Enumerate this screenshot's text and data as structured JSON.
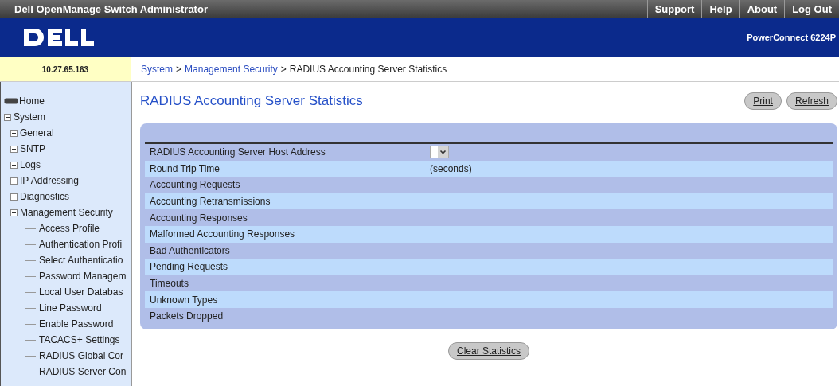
{
  "title_bar": {
    "title": "Dell OpenManage Switch Administrator",
    "links": [
      "Support",
      "Help",
      "About",
      "Log Out"
    ]
  },
  "header": {
    "product": "PowerConnect 6224P"
  },
  "ip_address": "10.27.65.163",
  "breadcrumb": [
    {
      "label": "System",
      "kind": "link"
    },
    {
      "label": ">",
      "kind": "sep"
    },
    {
      "label": "Management Security",
      "kind": "link"
    },
    {
      "label": ">",
      "kind": "sep"
    },
    {
      "label": "RADIUS Accounting Server Statistics",
      "kind": "current"
    }
  ],
  "sidebar": {
    "items": [
      {
        "label": "Home",
        "kind": "home"
      },
      {
        "label": "System",
        "kind": "folder",
        "expanded": true,
        "children": [
          {
            "label": "General",
            "kind": "folder",
            "expanded": false
          },
          {
            "label": "SNTP",
            "kind": "folder",
            "expanded": false
          },
          {
            "label": "Logs",
            "kind": "folder",
            "expanded": false
          },
          {
            "label": "IP Addressing",
            "kind": "folder",
            "expanded": false
          },
          {
            "label": "Diagnostics",
            "kind": "folder",
            "expanded": false
          },
          {
            "label": "Management Security",
            "kind": "folder",
            "expanded": true,
            "children": [
              {
                "label": "Access Profile",
                "kind": "leaf"
              },
              {
                "label": "Authentication Profi",
                "kind": "leaf"
              },
              {
                "label": "Select Authenticatio",
                "kind": "leaf"
              },
              {
                "label": "Password Managem",
                "kind": "leaf"
              },
              {
                "label": "Local User Databas",
                "kind": "leaf"
              },
              {
                "label": "Line Password",
                "kind": "leaf"
              },
              {
                "label": "Enable Password",
                "kind": "leaf"
              },
              {
                "label": "TACACS+ Settings",
                "kind": "leaf"
              },
              {
                "label": "RADIUS Global Cor",
                "kind": "leaf"
              },
              {
                "label": "RADIUS Server Con",
                "kind": "leaf"
              }
            ]
          }
        ]
      }
    ]
  },
  "page": {
    "title": "RADIUS Accounting Server Statistics",
    "buttons": [
      "Print",
      "Refresh"
    ],
    "rows": [
      {
        "label": "RADIUS Accounting Server Host Address",
        "kind": "select"
      },
      {
        "label": "Round Trip Time",
        "kind": "text",
        "value": "(seconds)"
      },
      {
        "label": "Accounting Requests",
        "kind": "text"
      },
      {
        "label": "Accounting Retransmissions",
        "kind": "text"
      },
      {
        "label": "Accounting Responses",
        "kind": "text"
      },
      {
        "label": "Malformed Accounting Responses",
        "kind": "text"
      },
      {
        "label": "Bad Authenticators",
        "kind": "text"
      },
      {
        "label": "Pending Requests",
        "kind": "text"
      },
      {
        "label": "Timeouts",
        "kind": "text"
      },
      {
        "label": "Unknown Types",
        "kind": "text"
      },
      {
        "label": "Packets Dropped",
        "kind": "text"
      }
    ],
    "clear_button": "Clear Statistics"
  }
}
